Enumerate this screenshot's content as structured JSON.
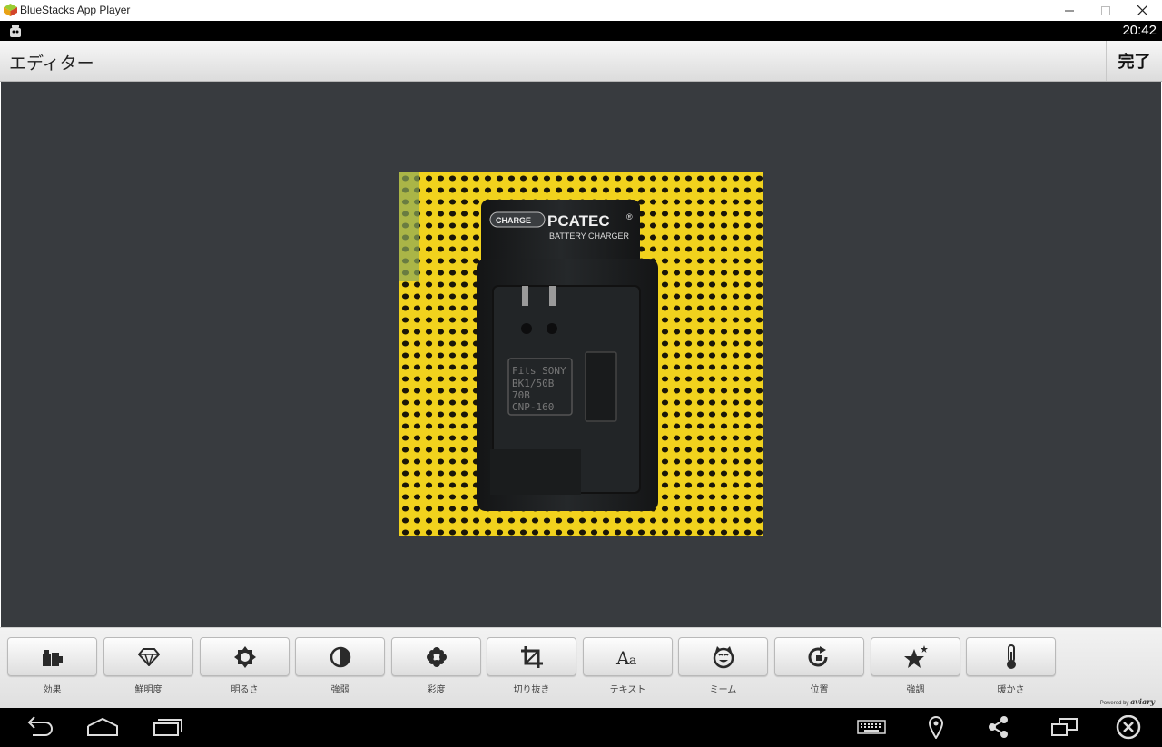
{
  "window": {
    "title": "BlueStacks App Player"
  },
  "status_bar": {
    "time": "20:42"
  },
  "action_bar": {
    "title": "エディター",
    "done_label": "完了"
  },
  "photo": {
    "brand": "PCATEC",
    "registered": "®",
    "subtitle": "BATTERY CHARGER",
    "charge_label": "CHARGE",
    "fits_lines": [
      "Fits SONY",
      "BK1/50B",
      "70B",
      "CNP-160"
    ]
  },
  "tools": [
    {
      "label": "効果",
      "icon": "effects-icon"
    },
    {
      "label": "鮮明度",
      "icon": "diamond-icon"
    },
    {
      "label": "明るさ",
      "icon": "brightness-icon"
    },
    {
      "label": "強弱",
      "icon": "contrast-icon"
    },
    {
      "label": "彩度",
      "icon": "saturation-icon"
    },
    {
      "label": "切り抜き",
      "icon": "crop-icon"
    },
    {
      "label": "テキスト",
      "icon": "text-icon"
    },
    {
      "label": "ミーム",
      "icon": "meme-icon"
    },
    {
      "label": "位置",
      "icon": "rotate-icon"
    },
    {
      "label": "強調",
      "icon": "enhance-icon"
    },
    {
      "label": "暖かさ",
      "icon": "thermometer-icon"
    }
  ],
  "powered_by": {
    "prefix": "Powered by",
    "brand": "aviary"
  },
  "nav_bar": {
    "icons": [
      "back-icon",
      "home-icon",
      "recents-icon",
      "keyboard-icon",
      "location-icon",
      "share-icon",
      "multiwindow-icon",
      "close-app-icon"
    ]
  },
  "colors": {
    "canvas": "#383b3f",
    "mesh_yellow": "#f1d21d",
    "charger": "#1d1f20"
  }
}
